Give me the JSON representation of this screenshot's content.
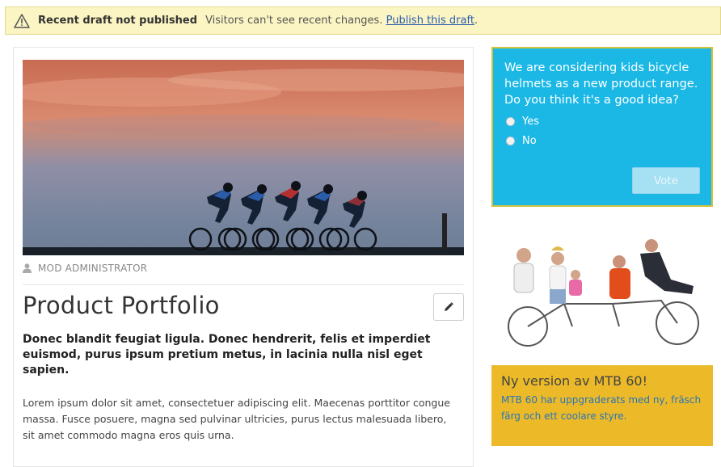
{
  "banner": {
    "title": "Recent draft not published",
    "message": "Visitors can't see recent changes.",
    "link": "Publish this draft",
    "suffix": "."
  },
  "article": {
    "author": "MOD ADMINISTRATOR",
    "title": "Product Portfolio",
    "lead": "Donec blandit feugiat ligula. Donec hendrerit, felis et imperdiet euismod, purus ipsum pretium metus, in lacinia nulla nisl eget sapien.",
    "body": "Lorem ipsum dolor sit amet, consectetuer adipiscing elit. Maecenas porttitor congue massa. Fusce posuere, magna sed pulvinar ultricies, purus lectus malesuada libero, sit amet commodo magna eros quis urna."
  },
  "poll": {
    "question": "We are considering kids bicycle helmets as a new product range. Do you think it's a good idea?",
    "options": [
      "Yes",
      "No"
    ],
    "vote_label": "Vote"
  },
  "promo": {
    "heading": "Ny version av MTB 60!",
    "text": "MTB 60 har uppgraderats med ny, fräsch färg och ett coolare styre."
  },
  "colors": {
    "banner_bg": "#fbf5c3",
    "poll_bg": "#1bb8e6",
    "promo_bg": "#ecba28",
    "link": "#2a5db0"
  },
  "icons": [
    "warning-icon",
    "user-icon",
    "pencil-icon"
  ]
}
